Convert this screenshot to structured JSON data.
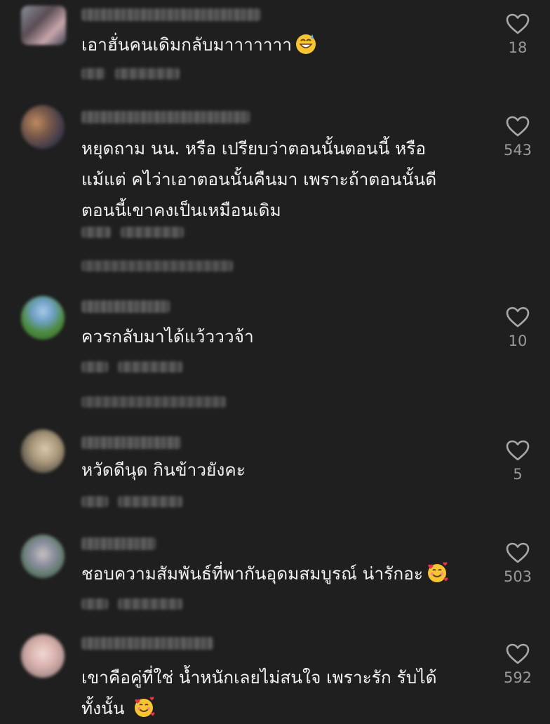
{
  "comments": [
    {
      "text": "เอาฮั่นคนเดิมกลับมาาาาาาา",
      "emoji": "grinning-sweat-emoji",
      "likes": "18",
      "has_replies": false
    },
    {
      "text": "หยุดถาม นน. หรือ เปรียบว่าตอนนั้นตอนนี้ หรือ\nแม้แต่ คไว่าเอาตอนนั้นคืนมา เพราะถ้าตอนนั้นดี\nตอนนี้เขาคงเป็นเหมือนเดิม",
      "emoji": "",
      "likes": "543",
      "has_replies": true
    },
    {
      "text": "ควรกลับมาได้แว้วววจ้า",
      "emoji": "",
      "likes": "10",
      "has_replies": true
    },
    {
      "text": "หวัดดีนุด กินข้าวยังคะ",
      "emoji": "",
      "likes": "5",
      "has_replies": false
    },
    {
      "text": "ชอบความสัมพันธ์ที่พากันอุดมสมบูรณ์ น่ารักอะ",
      "emoji": "smiling-hearts-emoji",
      "likes": "503",
      "has_replies": false
    },
    {
      "text": "เขาคือคู่ที่ใช่ น้ำหนักเลยไม่สนใจ เพราะรัก รับได้\nทั้งนั้น ",
      "emoji": "smiling-hearts-emoji",
      "likes": "592",
      "has_replies": false
    }
  ],
  "icons": {
    "like": "heart-outline-icon"
  },
  "colors": {
    "background": "#1f1f1f",
    "text": "#f2f2f2",
    "count": "#9a9a9a"
  }
}
